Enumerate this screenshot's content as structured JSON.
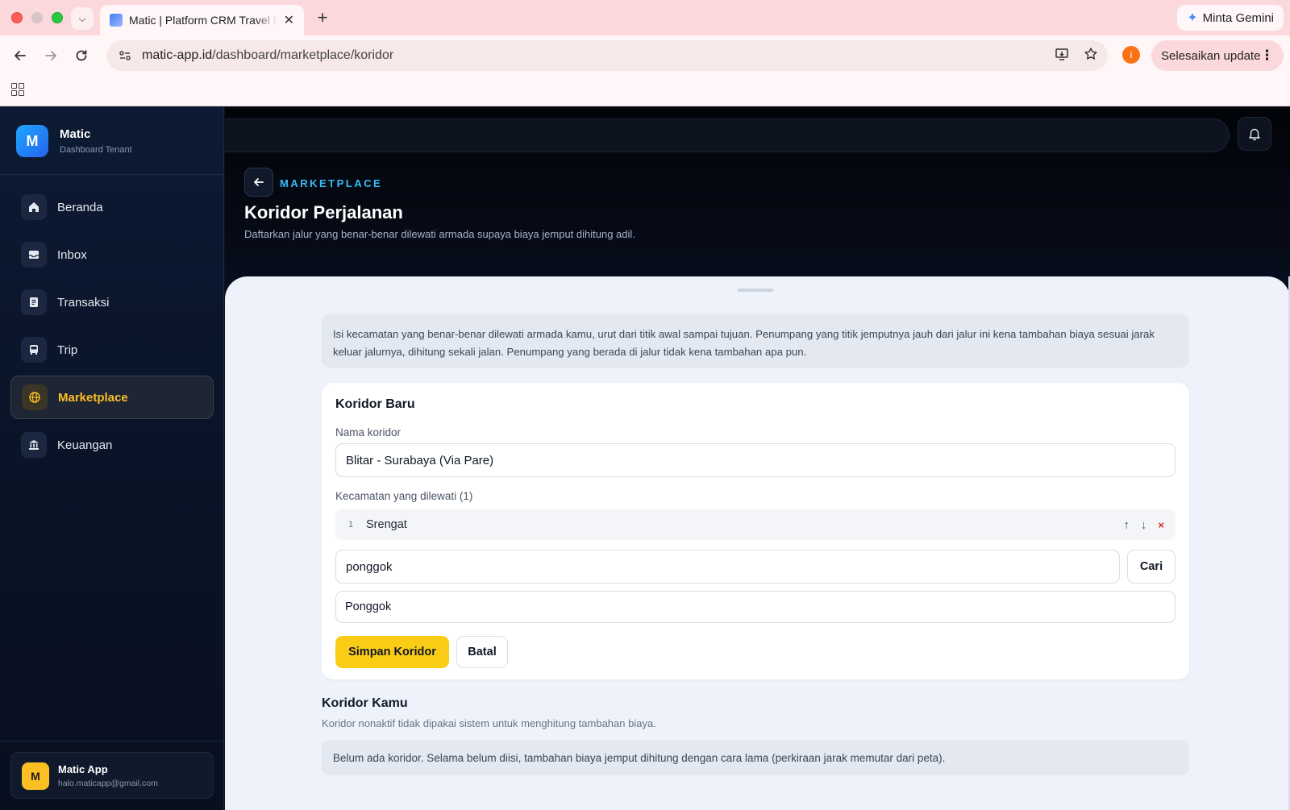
{
  "browser": {
    "tab_title": "Matic | Platform CRM Travel Digital",
    "url_host": "matic-app.id",
    "url_path": "/dashboard/marketplace/koridor",
    "gemini_label": "Minta Gemini",
    "profile_initial": "i",
    "update_label": "Selesaikan update"
  },
  "sidebar": {
    "brand_initial": "M",
    "brand_name": "Matic",
    "brand_sub": "Dashboard Tenant",
    "items": [
      {
        "label": "Beranda",
        "icon": "home-icon"
      },
      {
        "label": "Inbox",
        "icon": "inbox-icon"
      },
      {
        "label": "Transaksi",
        "icon": "receipt-icon"
      },
      {
        "label": "Trip",
        "icon": "bus-icon"
      },
      {
        "label": "Marketplace",
        "icon": "globe-icon",
        "active": true
      },
      {
        "label": "Keuangan",
        "icon": "bank-icon"
      }
    ],
    "user": {
      "initial": "M",
      "name": "Matic App",
      "email": "halo.maticapp@gmail.com"
    }
  },
  "header": {
    "eyebrow": "MARKETPLACE",
    "title": "Koridor Perjalanan",
    "description": "Daftarkan jalur yang benar-benar dilewati armada supaya biaya jemput dihitung adil."
  },
  "info_text": "Isi kecamatan yang benar-benar dilewati armada kamu, urut dari titik awal sampai tujuan. Penumpang yang titik jemputnya jauh dari jalur ini kena tambahan biaya sesuai jarak keluar jalurnya, dihitung sekali jalan. Penumpang yang berada di jalur tidak kena tambahan apa pun.",
  "form": {
    "title": "Koridor Baru",
    "name_label": "Nama koridor",
    "name_value": "Blitar - Surabaya (Via Pare)",
    "stops_label": "Kecamatan yang dilewati (1)",
    "stops": [
      {
        "num": "1",
        "name": "Srengat"
      }
    ],
    "stop_up": "↑",
    "stop_down": "↓",
    "stop_remove": "×",
    "search_value": "ponggok",
    "search_button": "Cari",
    "result": "Ponggok",
    "save_button": "Simpan Koridor",
    "cancel_button": "Batal"
  },
  "corridors": {
    "title": "Koridor Kamu",
    "subtitle": "Koridor nonaktif tidak dipakai sistem untuk menghitung tambahan biaya.",
    "empty_text": "Belum ada koridor. Selama belum diisi, tambahan biaya jemput dihitung dengan cara lama (perkiraan jarak memutar dari peta)."
  },
  "colors": {
    "accent_yellow": "#facc15",
    "eyebrow_blue": "#38bdf8",
    "remove_red": "#dc2626"
  }
}
